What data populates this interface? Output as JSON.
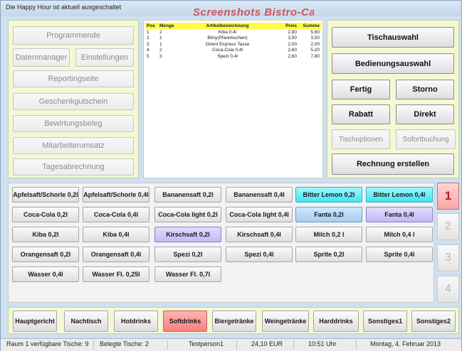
{
  "window": {
    "title": "Die Happy Hour ist aktuell ausgeschaltet",
    "watermark": "Screenshots Bistro-Cash"
  },
  "left_panel": {
    "programmende": "Programmende",
    "datenmanager": "Datenmanager",
    "einstellungen": "Einstellungen",
    "reportingseite": "Reportingseite",
    "geschenkgutschein": "Geschenkgutschein",
    "bewirtungsbeleg": "Bewirtungsbeleg",
    "mitarbeiterumsatz": "Mitarbeiterumsatz",
    "tagesabrechnung": "Tagesabrechnung"
  },
  "order": {
    "headers": {
      "pos": "Pos",
      "menge": "Menge",
      "artikel": "Artikelbezeichnung",
      "preis": "Preis",
      "summe": "Summe"
    },
    "rows": [
      {
        "pos": "1",
        "menge": "2",
        "artikel": "Kiba 0,4l",
        "preis": "2,80",
        "summe": "5,60"
      },
      {
        "pos": "2",
        "menge": "1",
        "artikel": "Bliny(Pfannkuchen)",
        "preis": "3,50",
        "summe": "3,50"
      },
      {
        "pos": "3",
        "menge": "1",
        "artikel": "Orient Express Tasse",
        "preis": "2,00",
        "summe": "2,00"
      },
      {
        "pos": "4",
        "menge": "2",
        "artikel": "Coca-Cola 0,4l",
        "preis": "2,60",
        "summe": "5,20"
      },
      {
        "pos": "5",
        "menge": "3",
        "artikel": "Spezi 0,4l",
        "preis": "2,60",
        "summe": "7,80"
      }
    ]
  },
  "right_panel": {
    "tischauswahl": "Tischauswahl",
    "bedienungsauswahl": "Bedienungsauswahl",
    "fertig": "Fertig",
    "storno": "Storno",
    "rabatt": "Rabatt",
    "direkt": "Direkt",
    "tischoptionen": "Tischoptionen",
    "sofortbuchung": "Sofortbuchung",
    "rechnung_erstellen": "Rechnung erstellen"
  },
  "products": {
    "row1": [
      "Apfelsaft/Schorle 0,2l",
      "Apfelsaft/Schorle 0,4l",
      "Bananensaft 0,2l",
      "Bananensaft 0,4l",
      "Bitter Lemon 0,2l",
      "Bitter Lemon 0,4l"
    ],
    "row2": [
      "Coca-Cola 0,2l",
      "Coca-Cola 0,4l",
      "Coca-Cola light 0,2l",
      "Coca-Cola light 0,4l",
      "Fanta 0,2l",
      "Fanta 0,4l"
    ],
    "row3": [
      "Kiba 0,2l",
      "Kiba 0,4l",
      "Kirschsaft 0,2l",
      "Kirschsaft 0,4l",
      "Milch 0,2 l",
      "Milch 0,4 l"
    ],
    "row4": [
      "Orangensaft 0,2l",
      "Orangensaft 0,4l",
      "Spezi 0,2l",
      "Spezi 0,4l",
      "Sprite 0,2l",
      "Sprite 0,4l"
    ],
    "row5": [
      "Wasser 0,4l",
      "Wasser Fl. 0,25l",
      "Wasser Fl. 0,7l"
    ]
  },
  "pager": {
    "p1": "1",
    "p2": "2",
    "p3": "3",
    "p4": "4"
  },
  "categories": [
    "Hauptgericht",
    "Nachtisch",
    "Hotdrinks",
    "Softdrinks",
    "Biergetränke",
    "Weingetränke",
    "Harddrinks",
    "Sonstiges1",
    "Sonstiges2"
  ],
  "status": {
    "raum": "Raum 1 verfügbare Tische: 9",
    "belegte": "Belegte Tische: 2",
    "person": "Testperson1",
    "betrag": "24,10 EUR",
    "uhrzeit": "10:51 Uhr",
    "datum": "Montag, 4. Februar 2013"
  },
  "colors": {
    "panel_background": "#f5f8d4",
    "window_background": "#cfe0f0",
    "active_category": "#f78080",
    "bitter_lemon": "#3fe6ee",
    "fanta_0_2": "#a4cdf4",
    "highlight_purple": "#c4b8f6",
    "active_page": "#f7a8a8"
  }
}
